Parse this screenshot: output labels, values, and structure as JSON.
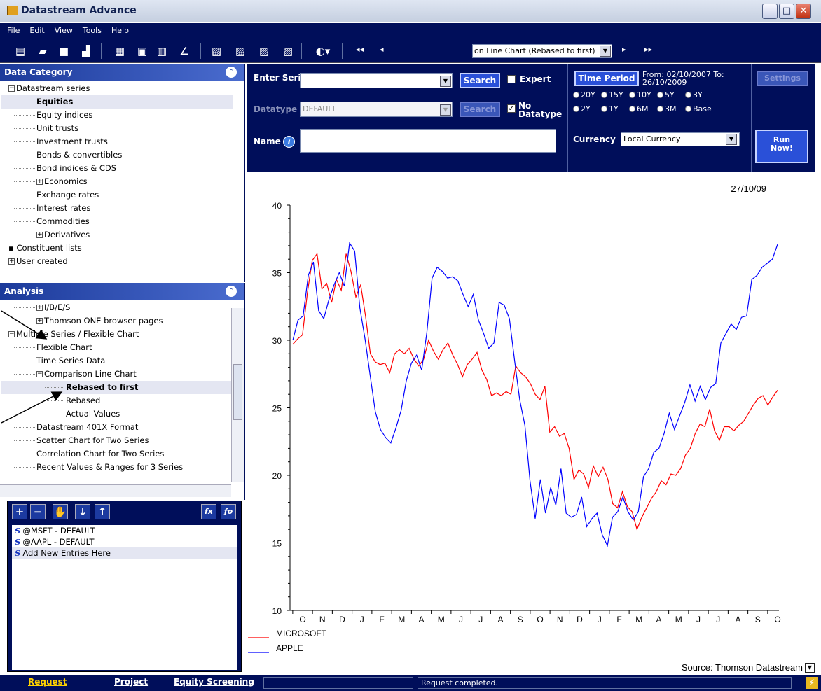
{
  "window": {
    "title": "Datastream Advance"
  },
  "menu": [
    "File",
    "Edit",
    "View",
    "Tools",
    "Help"
  ],
  "toolbar": {
    "chart_type_value": "on Line Chart (Rebased to first)"
  },
  "data_category": {
    "header": "Data Category",
    "items": [
      {
        "label": "Datastream series",
        "indent": 0,
        "box": "−"
      },
      {
        "label": "Equities",
        "indent": 1,
        "selected": true
      },
      {
        "label": "Equity indices",
        "indent": 1
      },
      {
        "label": "Unit trusts",
        "indent": 1
      },
      {
        "label": "Investment trusts",
        "indent": 1
      },
      {
        "label": "Bonds & convertibles",
        "indent": 1
      },
      {
        "label": "Bond indices & CDS",
        "indent": 1
      },
      {
        "label": "Economics",
        "indent": 1,
        "box": "+"
      },
      {
        "label": "Exchange rates",
        "indent": 1
      },
      {
        "label": "Interest rates",
        "indent": 1
      },
      {
        "label": "Commodities",
        "indent": 1
      },
      {
        "label": "Derivatives",
        "indent": 1,
        "box": "+"
      },
      {
        "label": "Constituent lists",
        "indent": 0,
        "bullet": true
      },
      {
        "label": "User created",
        "indent": 0,
        "box": "+"
      }
    ]
  },
  "analysis": {
    "header": "Analysis",
    "items": [
      {
        "label": "I/B/E/S",
        "indent": 1,
        "box": "+"
      },
      {
        "label": "Thomson ONE browser pages",
        "indent": 1,
        "box": "+"
      },
      {
        "label": "Multiple Series / Flexible Chart",
        "indent": 0,
        "box": "−"
      },
      {
        "label": "Flexible Chart",
        "indent": 1
      },
      {
        "label": "Time Series Data",
        "indent": 1
      },
      {
        "label": "Comparison Line Chart",
        "indent": 1,
        "box": "−"
      },
      {
        "label": "Rebased to first",
        "indent": 2,
        "selected": true
      },
      {
        "label": "Rebased",
        "indent": 2
      },
      {
        "label": "Actual Values",
        "indent": 2
      },
      {
        "label": "Datastream 401X Format",
        "indent": 1
      },
      {
        "label": "Scatter Chart for Two Series",
        "indent": 1
      },
      {
        "label": "Correlation Chart for Two Series",
        "indent": 1
      },
      {
        "label": "Recent Values & Ranges for 3 Series",
        "indent": 1
      }
    ]
  },
  "entries": {
    "items": [
      "@MSFT - DEFAULT",
      "@AAPL - DEFAULT",
      "Add New Entries Here"
    ]
  },
  "request": {
    "enter_series_label": "Enter Series",
    "search_btn": "Search",
    "expert_label": "Expert",
    "datatype_label": "Datatype",
    "datatype_value": "DEFAULT",
    "search_btn2": "Search",
    "no_datatype_label": "No Datatype",
    "name_label": "Name",
    "time_period_btn": "Time Period",
    "from_to": "From: 02/10/2007 To: 26/10/2009",
    "radios_row1": [
      "20Y",
      "15Y",
      "10Y",
      "5Y",
      "3Y"
    ],
    "radios_row2": [
      "2Y",
      "1Y",
      "6M",
      "3M",
      "Base"
    ],
    "currency_label": "Currency",
    "currency_value": "Local Currency",
    "settings_btn": "Settings",
    "run_btn": "Run Now!"
  },
  "status": {
    "tabs": [
      "Request",
      "Project",
      "Equity Screening"
    ],
    "message": "Request completed."
  },
  "chart_data": {
    "type": "line",
    "date_label": "27/10/09",
    "source": "Source: Thomson Datastream",
    "ylim": [
      10,
      40
    ],
    "yticks": [
      10,
      15,
      20,
      25,
      30,
      35,
      40
    ],
    "x_labels": [
      "O",
      "N",
      "D",
      "J",
      "F",
      "M",
      "A",
      "M",
      "J",
      "J",
      "A",
      "S",
      "O",
      "N",
      "D",
      "J",
      "F",
      "M",
      "A",
      "M",
      "J",
      "J",
      "A",
      "S",
      "O"
    ],
    "x_start": "2007-10-02",
    "x_end": "2009-10-26",
    "series": [
      {
        "name": "MICROSOFT",
        "color": "#ff0000",
        "values": [
          29.7,
          30.1,
          30.4,
          33.5,
          35.9,
          36.4,
          33.8,
          34.2,
          32.8,
          34.5,
          33.7,
          36.4,
          35.1,
          33.2,
          34.1,
          31.8,
          29.0,
          28.4,
          28.2,
          28.3,
          27.6,
          29.0,
          29.3,
          29.0,
          29.4,
          28.6,
          28.1,
          28.6,
          30.0,
          29.2,
          28.6,
          29.3,
          29.8,
          28.9,
          28.2,
          27.3,
          28.2,
          28.6,
          29.1,
          27.8,
          27.1,
          25.9,
          26.1,
          25.9,
          26.2,
          26.0,
          28.1,
          27.6,
          27.3,
          26.8,
          26.0,
          25.6,
          26.6,
          23.2,
          23.6,
          22.9,
          23.1,
          22.0,
          19.7,
          20.4,
          20.1,
          19.1,
          20.7,
          19.9,
          20.6,
          19.7,
          17.9,
          17.6,
          18.8,
          17.7,
          17.3,
          16.0,
          16.9,
          17.6,
          18.3,
          18.8,
          19.6,
          19.3,
          20.1,
          20.0,
          20.5,
          21.5,
          22.0,
          23.1,
          23.8,
          23.6,
          24.9,
          23.3,
          22.6,
          23.6,
          23.6,
          23.3,
          23.7,
          24.0,
          24.6,
          25.2,
          25.7,
          25.9,
          25.2,
          25.8,
          26.3
        ]
      },
      {
        "name": "APPLE",
        "color": "#0000ff",
        "values": [
          30.0,
          31.5,
          31.8,
          34.8,
          35.8,
          32.2,
          31.6,
          33.0,
          34.1,
          35.0,
          34.0,
          37.2,
          36.6,
          32.4,
          30.1,
          27.4,
          24.7,
          23.4,
          22.8,
          22.4,
          23.5,
          24.8,
          27.0,
          28.3,
          28.9,
          27.8,
          30.6,
          34.6,
          35.4,
          35.1,
          34.6,
          34.7,
          34.4,
          33.4,
          32.5,
          33.4,
          31.5,
          30.5,
          29.4,
          29.8,
          32.8,
          32.6,
          31.6,
          28.5,
          25.6,
          23.7,
          19.6,
          16.8,
          19.7,
          17.2,
          19.1,
          17.8,
          20.5,
          17.2,
          16.9,
          17.1,
          18.4,
          16.2,
          16.8,
          17.2,
          15.6,
          14.8,
          16.9,
          17.3,
          18.4,
          17.3,
          16.7,
          17.3,
          19.9,
          20.5,
          21.7,
          22.0,
          23.1,
          24.6,
          23.4,
          24.4,
          25.4,
          26.7,
          25.5,
          26.6,
          25.6,
          26.5,
          26.8,
          29.8,
          30.5,
          31.2,
          30.8,
          31.7,
          31.8,
          34.5,
          34.8,
          35.4,
          35.7,
          36.0,
          37.1
        ]
      }
    ]
  }
}
